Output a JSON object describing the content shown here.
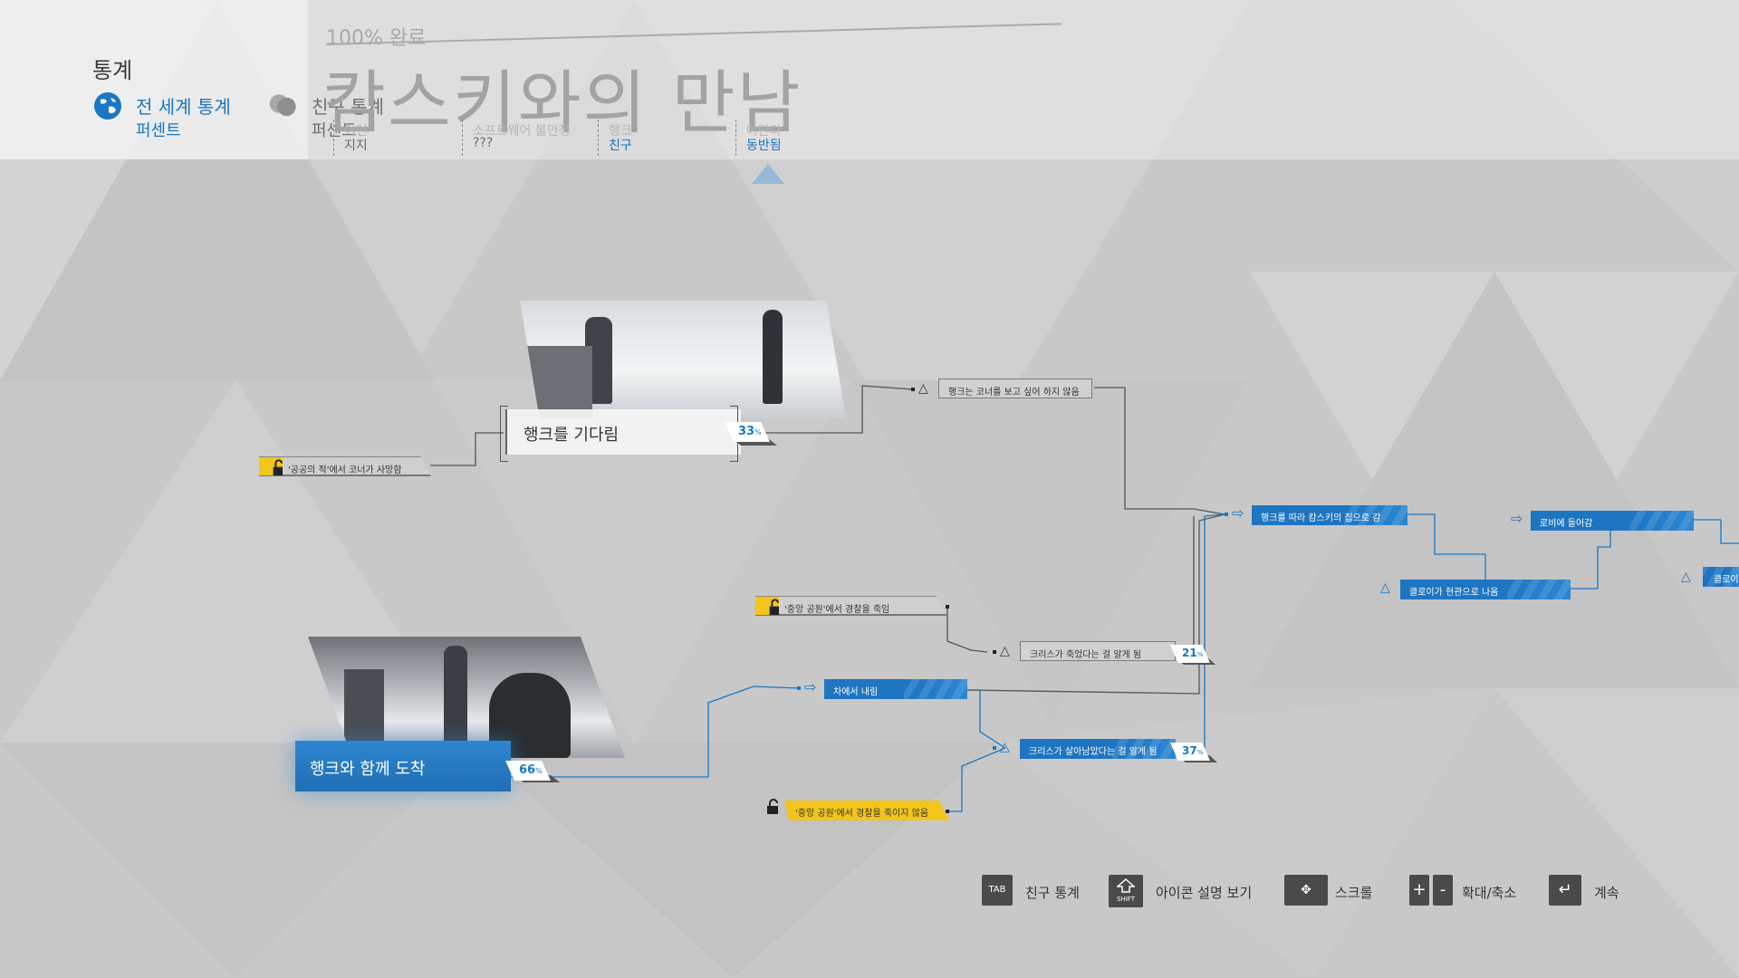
{
  "header": {
    "title": "통계",
    "tabs": [
      {
        "label": "전 세계 통계",
        "sub": "퍼센트",
        "active": true,
        "icon": "globe-icon"
      },
      {
        "label": "친구 통계",
        "sub": "퍼센트",
        "active": false,
        "icon": "friends-icon"
      }
    ],
    "progress": "100% 완료",
    "chapter": "캄스키와의 만남"
  },
  "legend": [
    {
      "faint": "이언",
      "value": "지지",
      "blue": false
    },
    {
      "faint": "소프트웨어 불안정",
      "value": "???",
      "blue": false
    },
    {
      "faint": "행크",
      "value": "친구",
      "blue": true
    },
    {
      "faint": "아만다",
      "value": "동반됨",
      "blue": true
    }
  ],
  "scenes": {
    "wait": {
      "title": "행크를 기다림",
      "percent": "33",
      "unit": "%"
    },
    "arrive": {
      "title": "행크와 함께 도착",
      "percent": "66",
      "unit": "%"
    }
  },
  "nodes": {
    "locked_connor_dies": "'공공의 적'에서 코너가 사망함",
    "hank_no_look": "행크는 코너를 보고 싶어 하지 않음",
    "follow_hank": "행크를 따라 캄스키의 집으로 감",
    "enter_lobby": "로비에 들어감",
    "chloe_exit": "클로이가 현관으로 나옴",
    "offscreen_partial": "클로이",
    "killed_cop": "'중앙 공원'에서 경찰을 죽임",
    "learn_chris_dead": "크리스가 죽었다는 걸 알게 됨",
    "learn_chris_dead_pct": "21",
    "exit_car": "차에서 내림",
    "learn_chris_alive": "크리스가 살아남았다는 걸 알게 됨",
    "learn_chris_alive_pct": "37",
    "spared_cop": "'중앙 공원'에서 경찰을 죽이지 않음",
    "pct_unit": "%"
  },
  "controls": [
    {
      "key": "TAB",
      "label": "친구 통계"
    },
    {
      "key": "SHIFT",
      "label": "아이콘 설명 보기"
    },
    {
      "key": "scroll",
      "label": "스크롤"
    },
    {
      "key": "+ -",
      "label": "확대/축소"
    },
    {
      "key": "enter",
      "label": "계속"
    }
  ],
  "colors": {
    "accent_blue": "#1e75c2",
    "locked_yellow": "#f2c51a",
    "background": "#c9c9c9"
  }
}
